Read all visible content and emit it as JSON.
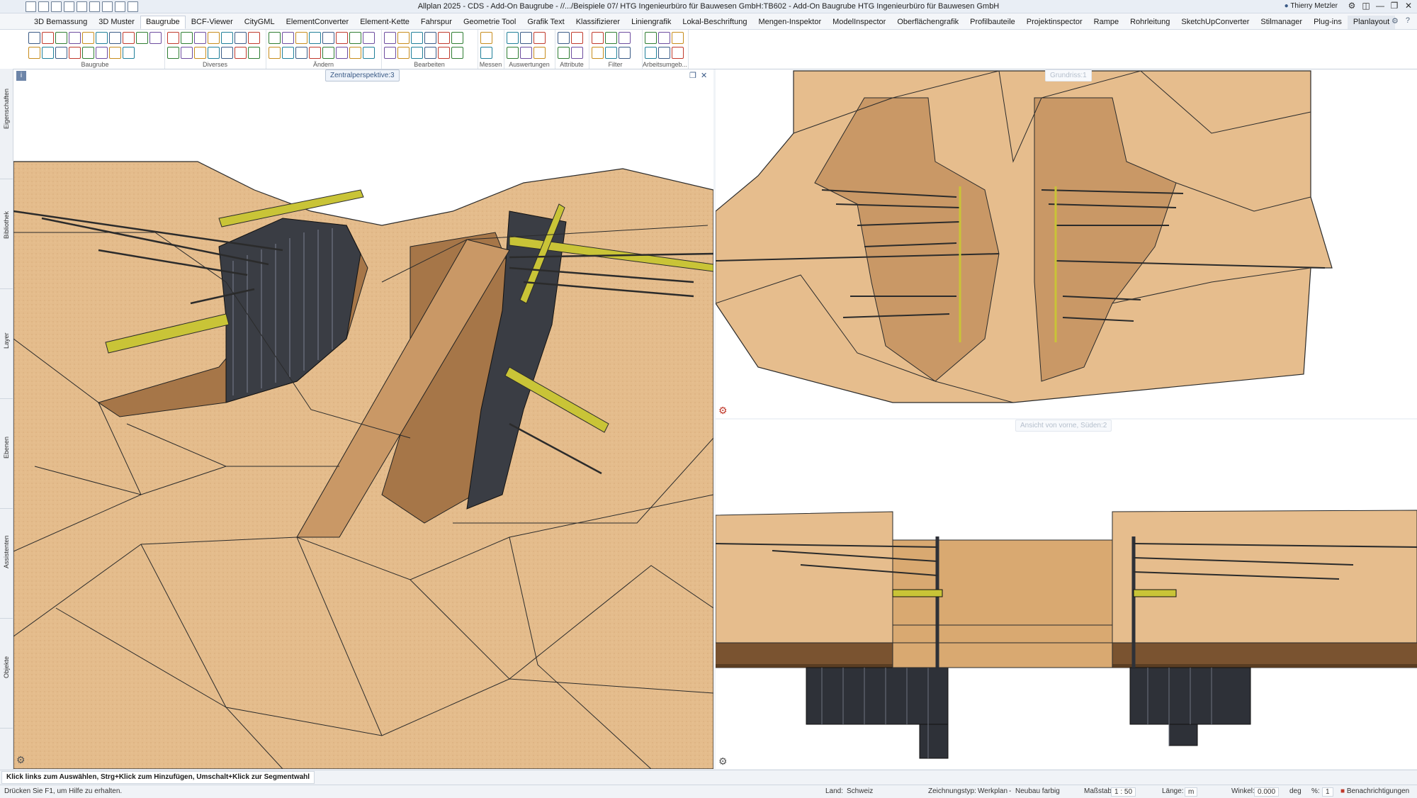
{
  "window": {
    "title": "Allplan 2025 - CDS - Add-On Baugrube - //.../Beispiele 07/ HTG Ingenieurbüro für Bauwesen GmbH:TB602 - Add-On Baugrube  HTG Ingenieurbüro für Bauwesen GmbH",
    "user": "Thierry Metzler"
  },
  "menu": {
    "tabs": [
      {
        "label": "3D Bemassung"
      },
      {
        "label": "3D Muster"
      },
      {
        "label": "Baugrube"
      },
      {
        "label": "BCF-Viewer"
      },
      {
        "label": "CityGML"
      },
      {
        "label": "ElementConverter"
      },
      {
        "label": "Element-Kette"
      },
      {
        "label": "Fahrspur"
      },
      {
        "label": "Geometrie Tool"
      },
      {
        "label": "Grafik Text"
      },
      {
        "label": "Klassifizierer"
      },
      {
        "label": "Liniengrafik"
      },
      {
        "label": "Lokal-Beschriftung"
      },
      {
        "label": "Mengen-Inspektor"
      },
      {
        "label": "ModelInspector"
      },
      {
        "label": "Oberflächengrafik"
      },
      {
        "label": "Profilbauteile"
      },
      {
        "label": "Projektinspector"
      },
      {
        "label": "Rampe"
      },
      {
        "label": "Rohrleitung"
      },
      {
        "label": "SketchUpConverter"
      },
      {
        "label": "Stilmanager"
      },
      {
        "label": "Plug-ins"
      },
      {
        "label": "Planlayout"
      }
    ]
  },
  "ribbon": {
    "groups": [
      {
        "label": "Baugrube"
      },
      {
        "label": "Diverses"
      },
      {
        "label": "Ändern"
      },
      {
        "label": "Bearbeiten"
      },
      {
        "label": "Messen"
      },
      {
        "label": "Auswertungen"
      },
      {
        "label": "Attribute"
      },
      {
        "label": "Filter"
      },
      {
        "label": "Arbeitsumgeb..."
      }
    ]
  },
  "sidebar": {
    "tabs": [
      {
        "label": "Eigenschaften"
      },
      {
        "label": "Bibliothek"
      },
      {
        "label": "Layer"
      },
      {
        "label": "Ebenen"
      },
      {
        "label": "Assistenten"
      },
      {
        "label": "Objekte"
      }
    ]
  },
  "viewports": {
    "perspective": "Zentralperspektive:3",
    "plan": "Grundriss:1",
    "front": "Ansicht von vorne, Süden:2"
  },
  "command_prompt": "Klick links zum Auswählen, Strg+Klick zum Hinzufügen, Umschalt+Klick zur Segmentwahl",
  "status": {
    "help": "Drücken Sie F1, um Hilfe zu erhalten.",
    "land_label": "Land:",
    "land_value": "Schweiz",
    "drawing_type_label": "Zeichnungstyp:",
    "drawing_type_value": "Werkplan",
    "drawing_style_value": "Neubau farbig",
    "scale_label": "Maßstab:",
    "scale_value": "1 : 50",
    "length_label": "Länge:",
    "length_value": "m",
    "angle_label": "Winkel:",
    "angle_value": "0.000",
    "angle_unit": "deg",
    "percent_label": "%:",
    "percent_value": "1",
    "notifications": "Benachrichtigungen"
  },
  "colors": {
    "terrain": "#e6bd8d",
    "terrain_dark": "#c99866",
    "terrain_shadow": "#a87a4c",
    "steel": "#2f333b",
    "beam_yellow": "#c9c437",
    "accent": "#3a5a86"
  }
}
